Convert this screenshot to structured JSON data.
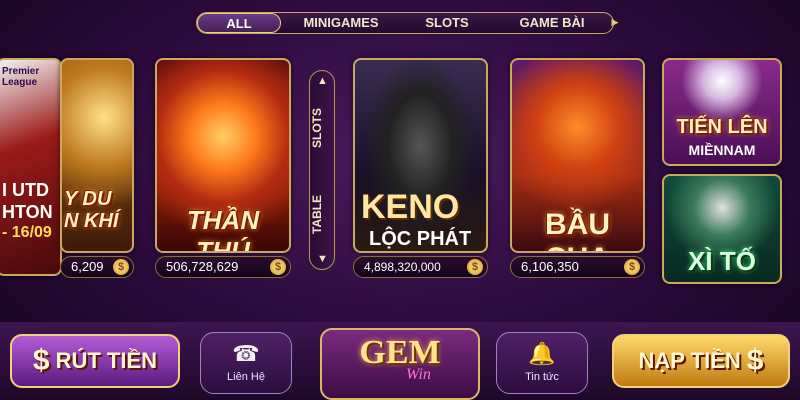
{
  "tabs": [
    {
      "label": "ALL",
      "active": true
    },
    {
      "label": "MINIGAMES",
      "active": false
    },
    {
      "label": "SLOTS",
      "active": false
    },
    {
      "label": "GAME BÀI",
      "active": false
    }
  ],
  "left_banner": {
    "league": "Premier League",
    "line1": "I UTD",
    "line2": "HTON",
    "date": "- 16/09"
  },
  "cards": [
    {
      "title": "Y DU\nN KHÍ",
      "jackpot": "6,209"
    },
    {
      "title": "THẦN THÚ",
      "jackpot": "506,728,629"
    },
    {
      "title": "KENO",
      "subtitle": "LỘC PHÁT",
      "jackpot": "4,898,320,000"
    },
    {
      "title": "BẦU CUA",
      "jackpot": "6,106,350"
    },
    {
      "title": "TIẾN LÊN",
      "subtitle": "MIỀNNAM"
    },
    {
      "title": "XÌ TỐ"
    }
  ],
  "switch": {
    "top": "SLOTS",
    "bottom": "TABLE"
  },
  "bottom_bar": {
    "withdraw": "RÚT TIỀN",
    "contact": "Liên Hệ",
    "logo_main": "GEM",
    "logo_sub": "Win",
    "news": "Tin tức",
    "deposit": "NẠP TIỀN"
  },
  "colors": {
    "accent_gold": "#caa860",
    "bg_purple": "#2a0a3a",
    "withdraw": "#7b2ea0",
    "deposit": "#d9a020"
  },
  "icons": {
    "phone": "phone-icon",
    "bell": "bell-icon",
    "dollar": "dollar-icon",
    "coin": "coin-icon"
  }
}
